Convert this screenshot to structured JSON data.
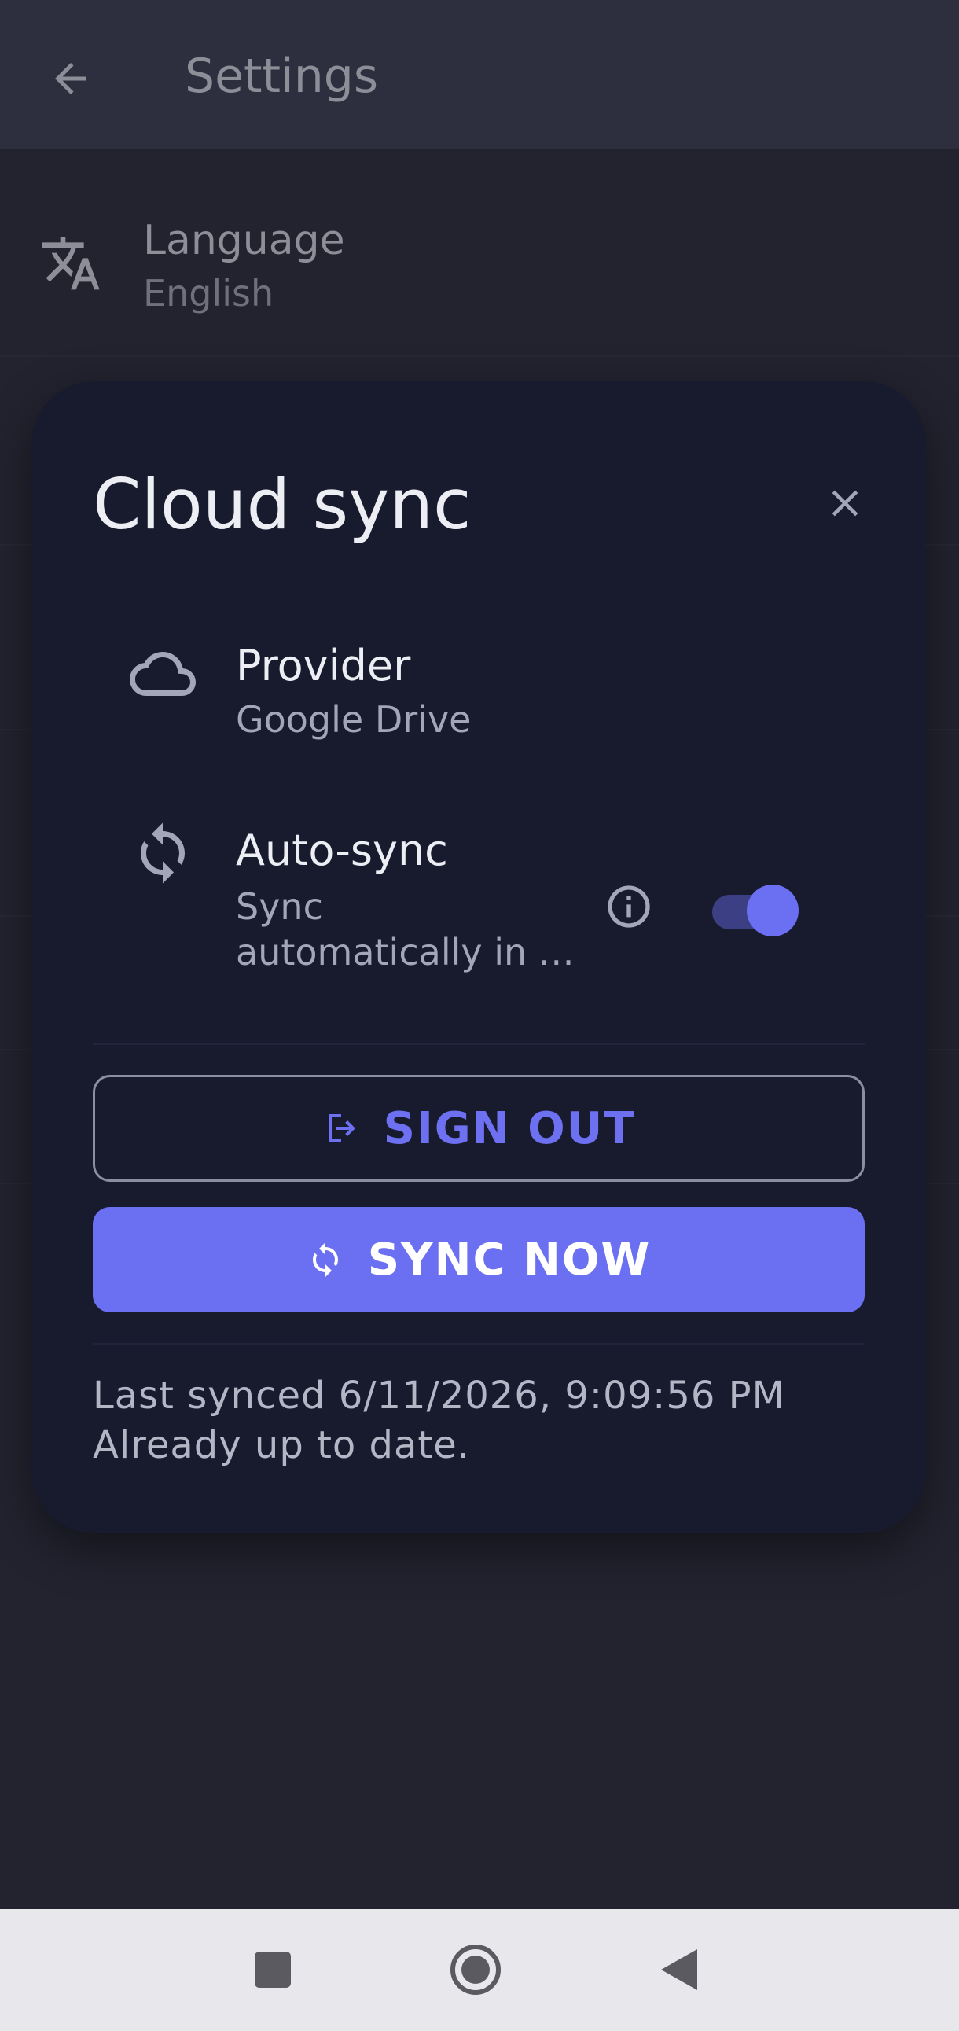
{
  "appbar": {
    "title": "Settings"
  },
  "settings": {
    "language": {
      "title": "Language",
      "value": "English"
    }
  },
  "dialog": {
    "title": "Cloud sync",
    "provider": {
      "title": "Provider",
      "value": "Google Drive"
    },
    "autosync": {
      "title": "Auto-sync",
      "subtitle_line1": "Sync",
      "subtitle_line2": "automatically in …",
      "enabled": true
    },
    "sign_out_label": "SIGN OUT",
    "sync_now_label": "SYNC NOW",
    "status": {
      "last_synced": "Last synced 6/11/2026, 9:09:56 PM",
      "message": "Already up to date."
    }
  },
  "colors": {
    "accent": "#6b6ff2",
    "dialog_bg": "#181b2e",
    "page_bg": "#22232f"
  },
  "icons": {
    "back": "arrow-left-icon",
    "language": "translate-icon",
    "close": "close-icon",
    "provider": "cloud-icon",
    "autosync": "sync-icon",
    "info": "info-icon",
    "sign_out": "logout-icon",
    "sync_now": "sync-icon",
    "nav_recents": "square-icon",
    "nav_home": "circle-icon",
    "nav_back": "triangle-back-icon"
  }
}
